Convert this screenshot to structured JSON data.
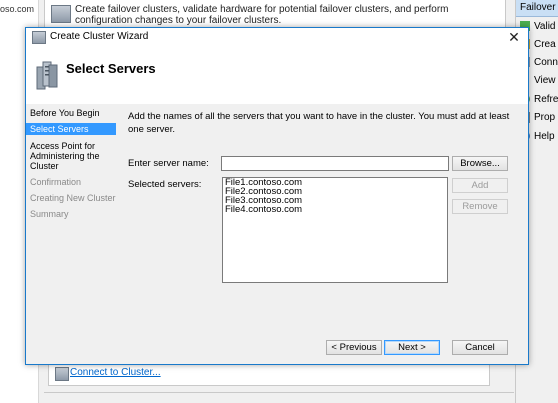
{
  "background": {
    "left_text": "oso.com",
    "top_text": "Create failover clusters, validate hardware for potential failover clusters, and perform configuration changes to your failover clusters.",
    "connect_link": "Connect to Cluster..."
  },
  "actions_pane": {
    "header": "Failover C",
    "items": [
      {
        "label": "Valid",
        "icon": "check-icon"
      },
      {
        "label": "Crea",
        "icon": "cluster-icon"
      },
      {
        "label": "Conn",
        "icon": "connect-icon"
      },
      {
        "label": "View",
        "icon": "view-icon"
      },
      {
        "label": "Refre",
        "icon": "refresh-icon"
      },
      {
        "label": "Prop",
        "icon": "properties-icon"
      },
      {
        "label": "Help",
        "icon": "help-icon"
      }
    ]
  },
  "dialog": {
    "title": "Create Cluster Wizard",
    "header_title": "Select Servers",
    "steps": [
      {
        "label": "Before You Begin",
        "state": "normal"
      },
      {
        "label": "Select Servers",
        "state": "active"
      },
      {
        "label": "Access Point for Administering the Cluster",
        "state": "normal"
      },
      {
        "label": "Confirmation",
        "state": "disabled"
      },
      {
        "label": "Creating New Cluster",
        "state": "disabled"
      },
      {
        "label": "Summary",
        "state": "disabled"
      }
    ],
    "instruction": "Add the names of all the servers that you want to have in the cluster. You must add at least one server.",
    "server_name_label": "Enter server name:",
    "server_name_value": "",
    "browse_label": "Browse...",
    "selected_label": "Selected servers:",
    "selected_servers": [
      "File1.contoso.com",
      "File2.contoso.com",
      "File3.contoso.com",
      "File4.contoso.com"
    ],
    "add_label": "Add",
    "remove_label": "Remove",
    "previous_label": "< Previous",
    "next_label": "Next >",
    "cancel_label": "Cancel"
  },
  "colors": {
    "accent": "#3399ff",
    "dialog_border": "#1979ca",
    "link": "#0066cc"
  }
}
